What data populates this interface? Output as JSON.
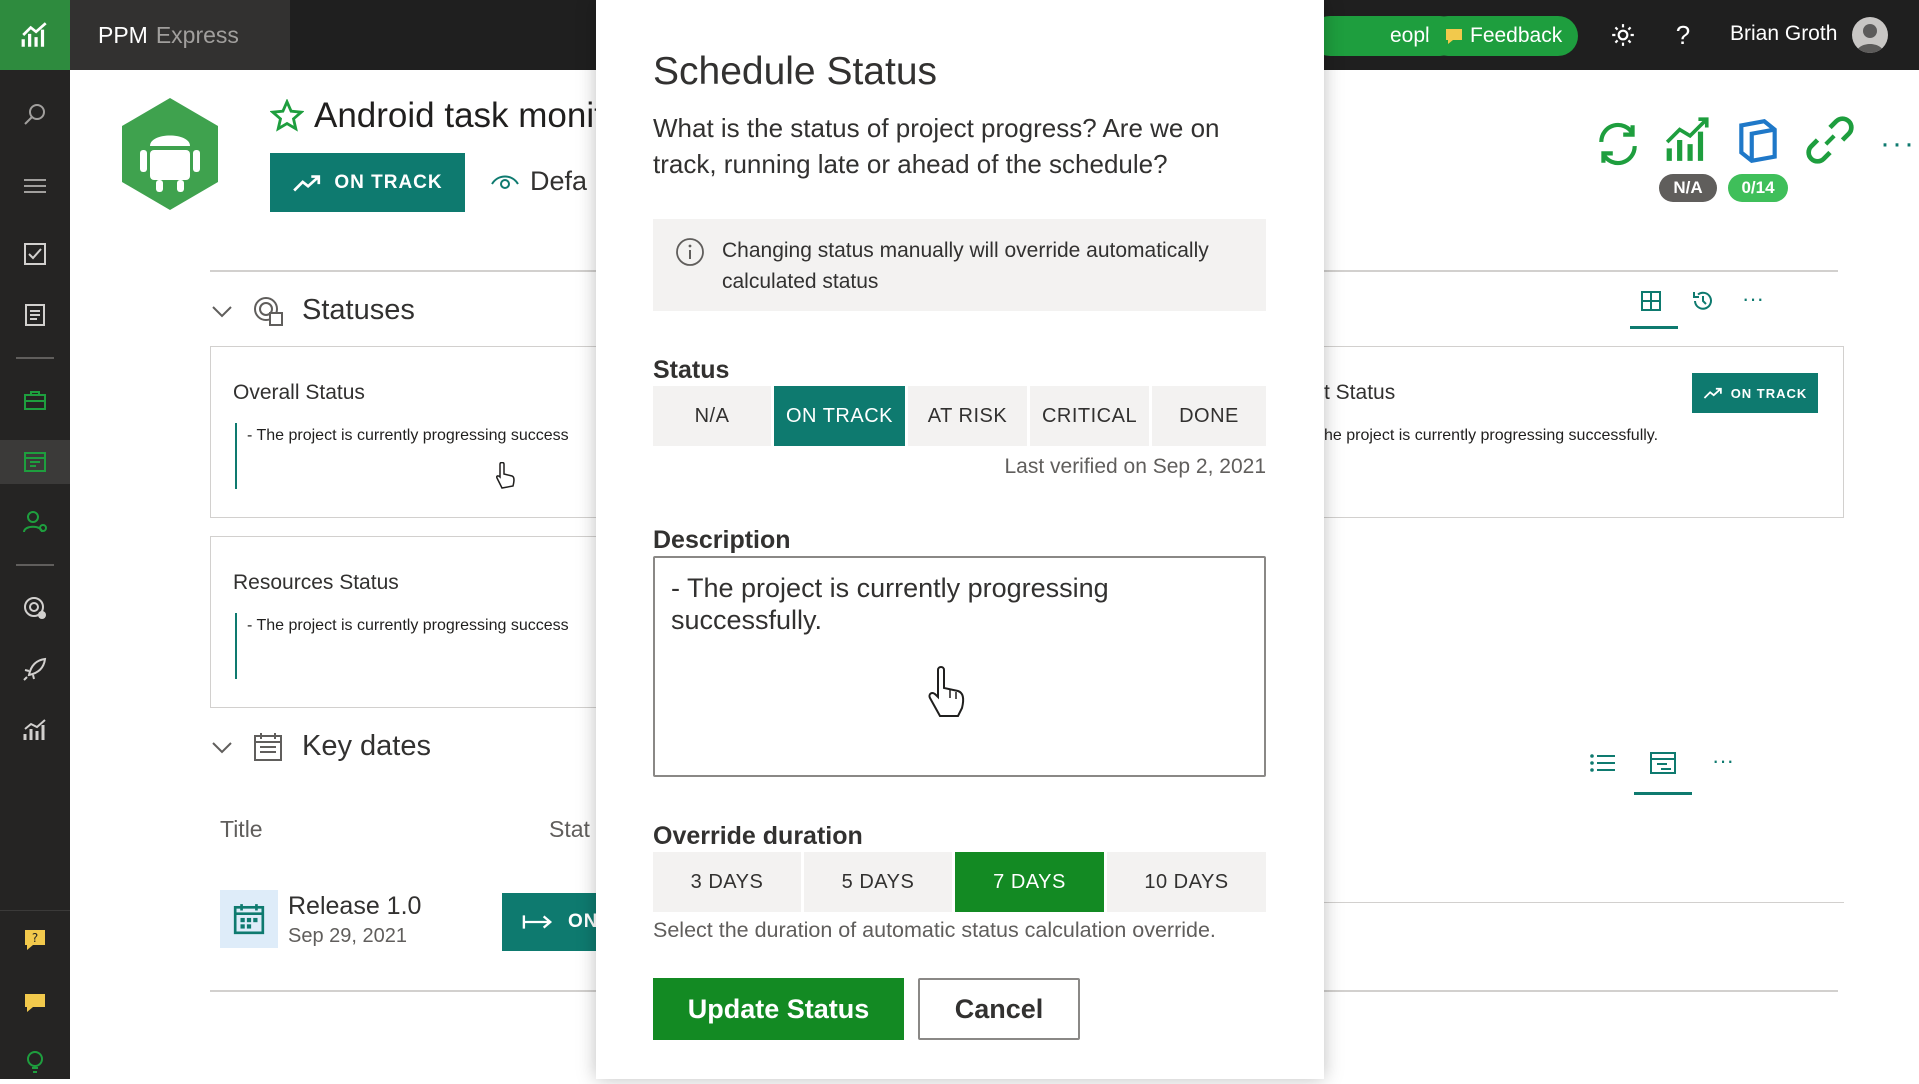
{
  "app": {
    "brand_primary": "PPM",
    "brand_secondary": "Express",
    "people_label": "eople",
    "feedback_label": "Feedback",
    "user_name": "Brian Groth"
  },
  "colors": {
    "accent_teal": "#0e7a6f",
    "accent_green": "#138a23",
    "rail_bg": "#252423",
    "topbar_bg": "#1f1f1f"
  },
  "project": {
    "title": "Android task monit",
    "header_status": "ON TRACK",
    "default_view": "Defa",
    "badges": {
      "insights": "N/A",
      "tasks": "0/14"
    }
  },
  "statuses_section": {
    "title": "Statuses",
    "cards": [
      {
        "title": "Overall Status",
        "text": "- The project is currently progressing success"
      },
      {
        "title": "Resources Status",
        "text": "- The project is currently progressing success"
      },
      {
        "title": "t Status",
        "text": "he project is currently progressing successfully.",
        "status": "ON TRACK"
      }
    ]
  },
  "key_dates": {
    "title": "Key dates",
    "col_title": "Title",
    "col_status": "Stat",
    "rows": [
      {
        "title": "Release 1.0",
        "date": "Sep 29, 2021",
        "status": "ON"
      }
    ]
  },
  "modal": {
    "title": "Schedule Status",
    "question": "What is the status of project progress? Are we on track, running late or ahead of the schedule?",
    "info": "Changing status manually will override automatically calculated status",
    "status_label": "Status",
    "status_options": [
      "N/A",
      "ON TRACK",
      "AT RISK",
      "CRITICAL",
      "DONE"
    ],
    "status_selected": "ON TRACK",
    "last_verified": "Last verified on Sep 2, 2021",
    "description_label": "Description",
    "description_value": "- The project is currently progressing successfully.",
    "override_label": "Override duration",
    "duration_options": [
      "3 DAYS",
      "5 DAYS",
      "7 DAYS",
      "10 DAYS"
    ],
    "duration_selected": "7 DAYS",
    "duration_hint": "Select the duration of automatic status calculation override.",
    "update_button": "Update Status",
    "cancel_button": "Cancel"
  }
}
